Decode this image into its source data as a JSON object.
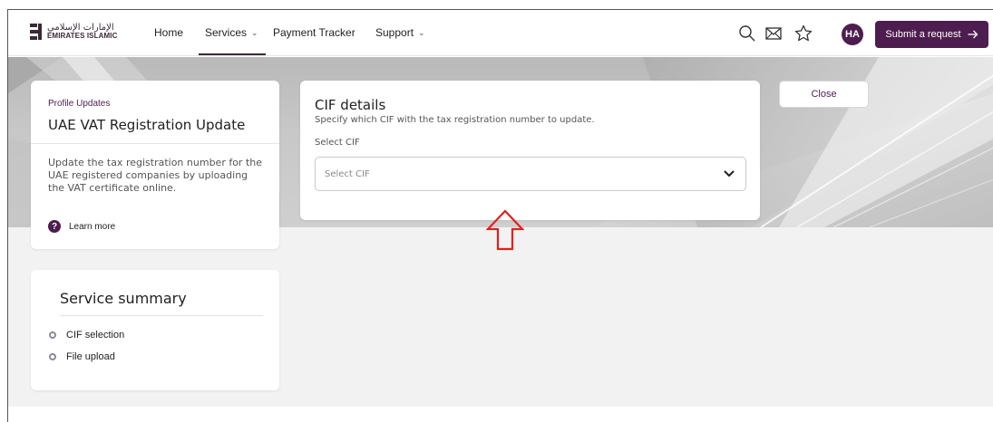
{
  "brand": {
    "name_ar": "الإمارات الإسلامي",
    "name_en": "EMIRATES ISLAMIC"
  },
  "nav": {
    "home": "Home",
    "services": "Services",
    "payment_tracker": "Payment Tracker",
    "support": "Support"
  },
  "header": {
    "avatar_initials": "HA",
    "submit_label": "Submit a request",
    "icons": [
      "search-icon",
      "mail-icon",
      "star-icon",
      "arrow-right-icon"
    ]
  },
  "profile_card": {
    "category": "Profile Updates",
    "title": "UAE VAT Registration Update",
    "description": "Update the tax registration number for the UAE registered companies by uploading the VAT certificate online.",
    "learn_more": "Learn more"
  },
  "summary_card": {
    "title": "Service summary",
    "items": [
      "CIF selection",
      "File upload"
    ]
  },
  "cif_card": {
    "title": "CIF details",
    "subtitle": "Specify which CIF with the tax registration number to update.",
    "select_label": "Select CIF",
    "select_placeholder": "Select CIF"
  },
  "close_label": "Close",
  "colors": {
    "brand": "#4e1d4f",
    "annotation_arrow": "#e02020",
    "hero_bg": "#c4c4c4",
    "page_bg": "#f3f2f2"
  }
}
